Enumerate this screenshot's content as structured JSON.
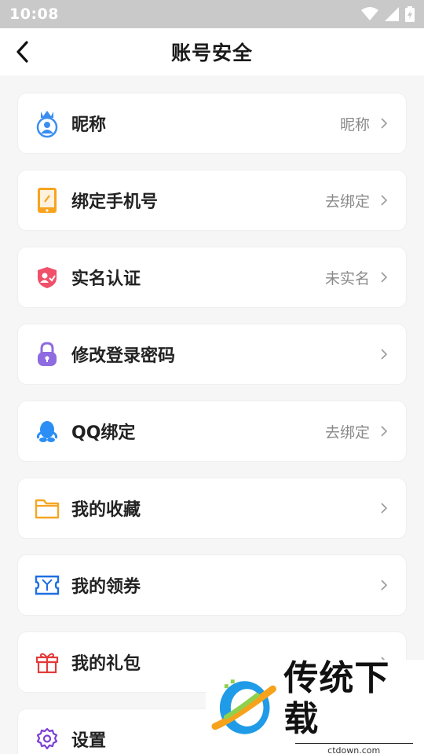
{
  "status_bar": {
    "time": "10:08"
  },
  "header": {
    "title": "账号安全"
  },
  "items": [
    {
      "label": "昵称",
      "value": "昵称"
    },
    {
      "label": "绑定手机号",
      "value": "去绑定"
    },
    {
      "label": "实名认证",
      "value": "未实名"
    },
    {
      "label": "修改登录密码",
      "value": ""
    },
    {
      "label": "QQ绑定",
      "value": "去绑定"
    },
    {
      "label": "我的收藏",
      "value": ""
    },
    {
      "label": "我的领券",
      "value": ""
    },
    {
      "label": "我的礼包",
      "value": ""
    },
    {
      "label": "设置",
      "value": ""
    }
  ],
  "watermark": {
    "brand": "传统下载",
    "domain": "ctdown.com"
  },
  "colors": {
    "statusbar": "#c9c9c9",
    "background": "#f6f6f6",
    "card": "#ffffff",
    "value_text": "#8a8a8a"
  }
}
